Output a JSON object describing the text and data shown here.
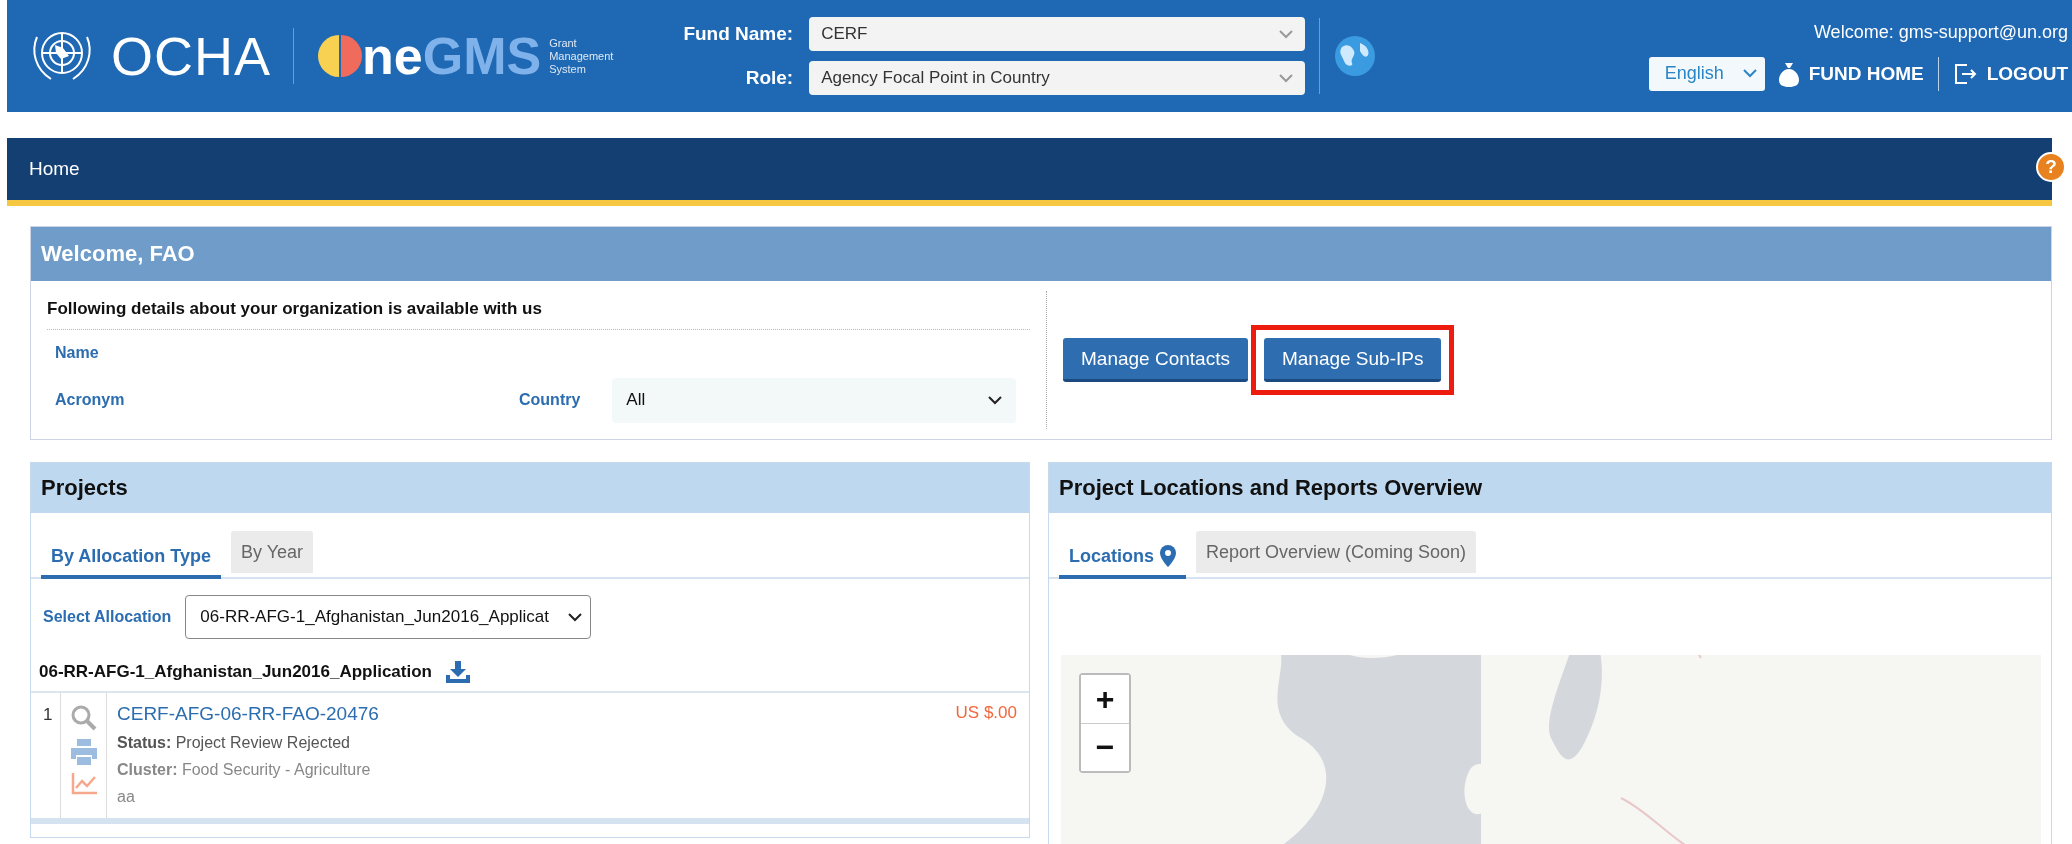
{
  "header": {
    "org": "OCHA",
    "brand_text": "ne",
    "brand_accent": "GMS",
    "tagline": [
      "Grant",
      "Management",
      "System"
    ],
    "fields": [
      {
        "label": "Fund Name:",
        "value": "CERF"
      },
      {
        "label": "Role:",
        "value": "Agency Focal Point in Country"
      }
    ],
    "welcome": "Welcome: gms-support@un.org",
    "language": "English",
    "links": [
      {
        "kind": "fund",
        "label": "FUND HOME"
      },
      {
        "kind": "logout",
        "label": "LOGOUT"
      }
    ]
  },
  "nav": {
    "items": [
      {
        "label": "Home"
      }
    ],
    "help": "?"
  },
  "welcome_panel": {
    "title": "Welcome, FAO",
    "intro": "Following details about your organization is available with us",
    "name_label": "Name",
    "acronym_label": "Acronym",
    "country_label": "Country",
    "country_value": "All",
    "buttons": [
      {
        "label": "Manage Contacts",
        "highlighted": false
      },
      {
        "label": "Manage Sub-IPs",
        "highlighted": true
      }
    ]
  },
  "projects": {
    "title": "Projects",
    "tabs": [
      {
        "label": "By Allocation Type",
        "selected": true
      },
      {
        "label": "By Year",
        "selected": false
      }
    ],
    "select_label": "Select Allocation",
    "select_value": "06-RR-AFG-1_Afghanistan_Jun2016_Applicat",
    "group": "06-RR-AFG-1_Afghanistan_Jun2016_Application",
    "rows": [
      {
        "index": "1",
        "code": "CERF-AFG-06-RR-FAO-20476",
        "amount": "US $.00",
        "status_label": "Status:",
        "status": "Project Review Rejected",
        "cluster_label": "Cluster:",
        "cluster": "Food Security - Agriculture",
        "note": "aa"
      }
    ]
  },
  "locations": {
    "title": "Project Locations and Reports Overview",
    "tabs": [
      {
        "label": "Locations",
        "selected": true,
        "kind": "pin"
      },
      {
        "label": "Report Overview (Coming Soon)",
        "selected": false,
        "kind": "plain"
      }
    ],
    "map": {
      "kind": "picture",
      "zoom_in": "+",
      "zoom_out": "−"
    }
  }
}
